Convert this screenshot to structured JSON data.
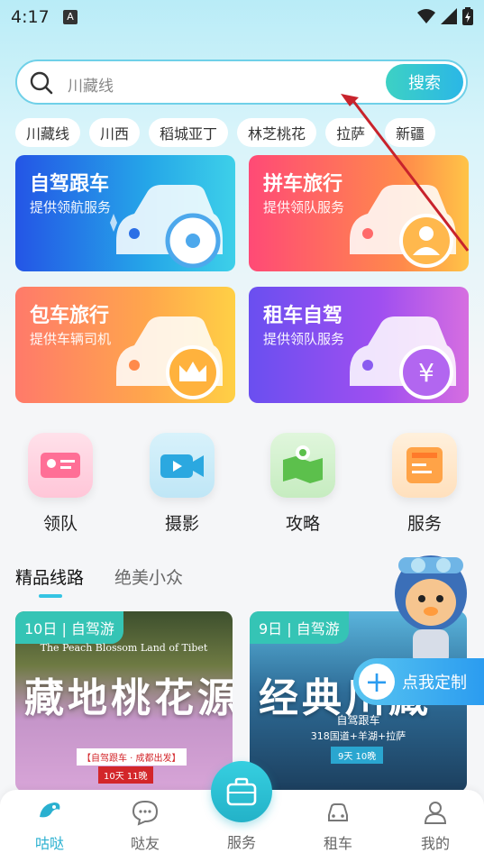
{
  "status_bar": {
    "time": "4:17",
    "notification": "A"
  },
  "search": {
    "placeholder": "川藏线",
    "button_label": "搜索"
  },
  "tags": [
    "川藏线",
    "川西",
    "稻城亚丁",
    "林芝桃花",
    "拉萨",
    "新疆"
  ],
  "service_cards": [
    {
      "title": "自驾跟车",
      "subtitle": "提供领航服务"
    },
    {
      "title": "拼车旅行",
      "subtitle": "提供领队服务"
    },
    {
      "title": "包车旅行",
      "subtitle": "提供车辆司机"
    },
    {
      "title": "租车自驾",
      "subtitle": "提供领队服务"
    }
  ],
  "quick_links": [
    "领队",
    "摄影",
    "攻略",
    "服务"
  ],
  "content_tabs": {
    "active": "精品线路",
    "inactive": "绝美小众"
  },
  "routes": [
    {
      "badge": "10日 | 自驾游",
      "subtitle": "The Peach Blossom Land of Tibet",
      "title": "藏地桃花源",
      "tag1": "【自驾跟车 · 成都出发】",
      "tag2": "10天 11晚"
    },
    {
      "badge": "9日 | 自驾游",
      "title": "经典川藏",
      "line1": "自驾跟车",
      "line2": "318国道+羊湖+拉萨",
      "tag": "9天 10晚"
    }
  ],
  "custom_button": {
    "label": "点我定制"
  },
  "bottom_nav": [
    "咕哒",
    "哒友",
    "服务",
    "租车",
    "我的"
  ],
  "colors": {
    "accent": "#35c4e3",
    "active_nav": "#2ab0d0"
  }
}
